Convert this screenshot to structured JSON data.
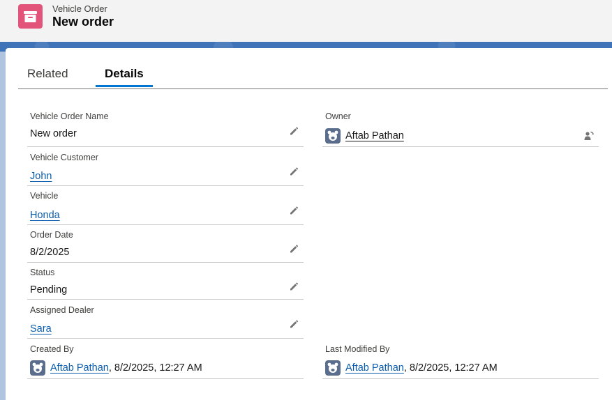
{
  "header": {
    "object_label": "Vehicle Order",
    "title": "New order",
    "icon": "archive-box-icon",
    "icon_color": "#e3547a"
  },
  "tabs": [
    {
      "label": "Related",
      "selected": false
    },
    {
      "label": "Details",
      "selected": true
    }
  ],
  "fields": {
    "vehicle_order_name": {
      "label": "Vehicle Order Name",
      "value": "New order"
    },
    "vehicle_customer": {
      "label": "Vehicle Customer",
      "value": "John"
    },
    "vehicle": {
      "label": "Vehicle",
      "value": "Honda"
    },
    "order_date": {
      "label": "Order Date",
      "value": "8/2/2025"
    },
    "status": {
      "label": "Status",
      "value": "Pending"
    },
    "assigned_dealer": {
      "label": "Assigned Dealer",
      "value": "Sara"
    },
    "owner": {
      "label": "Owner",
      "value": "Aftab Pathan"
    },
    "created_by": {
      "label": "Created By",
      "user": "Aftab Pathan",
      "date": ", 8/2/2025, 12:27 AM"
    },
    "last_modified_by": {
      "label": "Last Modified By",
      "user": "Aftab Pathan",
      "date": ", 8/2/2025, 12:27 AM"
    }
  },
  "colors": {
    "link": "#0b5cab",
    "tab_underline": "#0176d3",
    "avatar_bg": "#5a6d8c"
  }
}
